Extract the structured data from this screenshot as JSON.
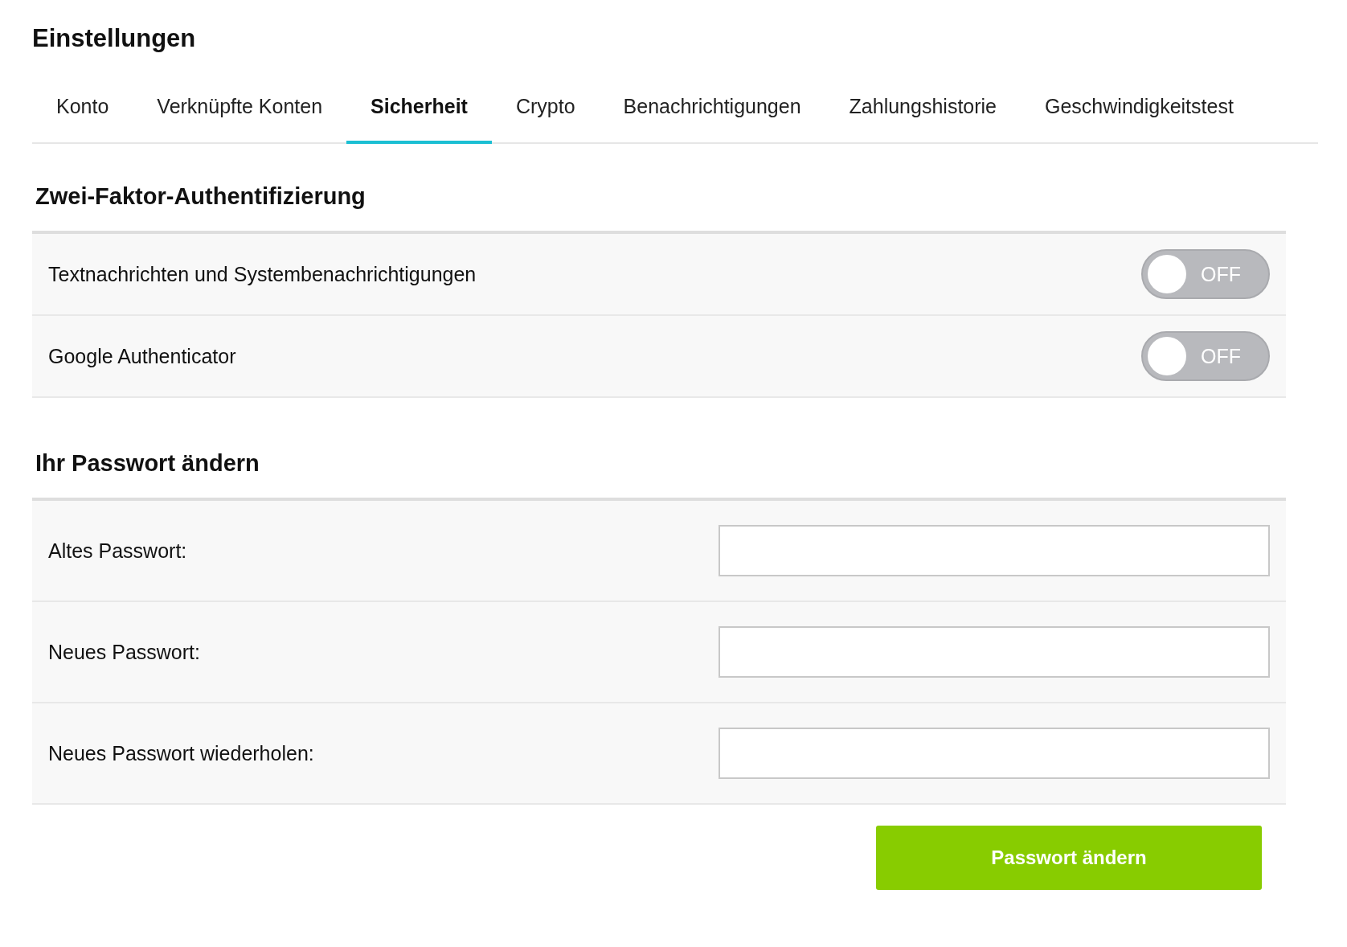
{
  "title": "Einstellungen",
  "tabs": [
    {
      "label": "Konto",
      "selected": false
    },
    {
      "label": "Verknüpfte Konten",
      "selected": false
    },
    {
      "label": "Sicherheit",
      "selected": true
    },
    {
      "label": "Crypto",
      "selected": false
    },
    {
      "label": "Benachrichtigungen",
      "selected": false
    },
    {
      "label": "Zahlungshistorie",
      "selected": false
    },
    {
      "label": "Geschwindigkeitstest",
      "selected": false
    }
  ],
  "two_factor": {
    "heading": "Zwei-Faktor-Authentifizierung",
    "items": [
      {
        "label": "Textnachrichten und Systembenachrichtigungen",
        "on": false,
        "state_text": "OFF"
      },
      {
        "label": "Google Authenticator",
        "on": false,
        "state_text": "OFF"
      }
    ]
  },
  "password": {
    "heading": "Ihr Passwort ändern",
    "fields": [
      {
        "label": "Altes Passwort:"
      },
      {
        "label": "Neues Passwort:"
      },
      {
        "label": "Neues Passwort wiederholen:"
      }
    ],
    "button": "Passwort ändern"
  }
}
